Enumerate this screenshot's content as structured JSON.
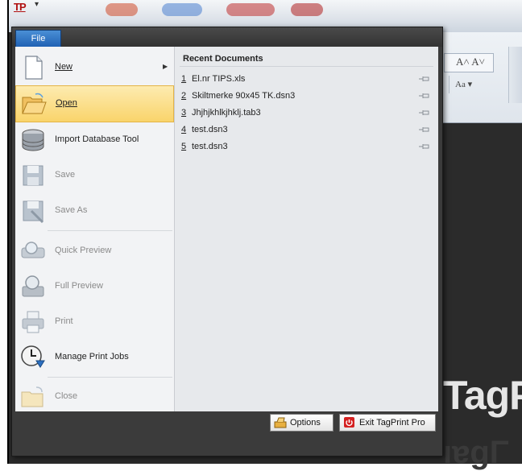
{
  "app": {
    "qat_logo": "TP",
    "qat_arrow": "▾",
    "ribbon_aa_label": "Aa ▾",
    "ribbon_font_grow": "A˄ A˅",
    "background_text": "TagP",
    "background_text_reflection": "ıɐgΓ"
  },
  "menu": {
    "tab_label": "File",
    "items": [
      {
        "label": "New",
        "enabled": true,
        "submenu": true,
        "icon": "new-document-icon"
      },
      {
        "label": "Open",
        "enabled": true,
        "highlighted": true,
        "icon": "open-folder-icon"
      },
      {
        "label": "Import Database Tool",
        "enabled": true,
        "icon": "database-icon"
      },
      {
        "label": "Save",
        "enabled": false,
        "icon": "save-disk-icon"
      },
      {
        "label": "Save As",
        "enabled": false,
        "icon": "save-as-icon"
      },
      {
        "label": "Quick Preview",
        "enabled": false,
        "icon": "quick-preview-icon"
      },
      {
        "label": "Full Preview",
        "enabled": false,
        "icon": "full-preview-icon"
      },
      {
        "label": "Print",
        "enabled": false,
        "icon": "printer-icon"
      },
      {
        "label": "Manage Print Jobs",
        "enabled": true,
        "icon": "print-jobs-clock-icon"
      },
      {
        "label": "Close",
        "enabled": false,
        "icon": "close-folder-icon"
      }
    ],
    "submenu_arrow": "▶"
  },
  "recent": {
    "title": "Recent Documents",
    "items": [
      {
        "num": "1",
        "name": "El.nr TIPS.xls"
      },
      {
        "num": "2",
        "name": "Skiltmerke 90x45 TK.dsn3"
      },
      {
        "num": "3",
        "name": "Jhjhjkhlkjhklj.tab3"
      },
      {
        "num": "4",
        "name": "test.dsn3"
      },
      {
        "num": "5",
        "name": "test.dsn3"
      }
    ]
  },
  "footer": {
    "options_label": "Options",
    "exit_label": "Exit TagPrint Pro"
  },
  "colors": {
    "highlight": "#f9d46b",
    "file_tab": "#2a6fc4",
    "exit_icon": "#d42020"
  }
}
